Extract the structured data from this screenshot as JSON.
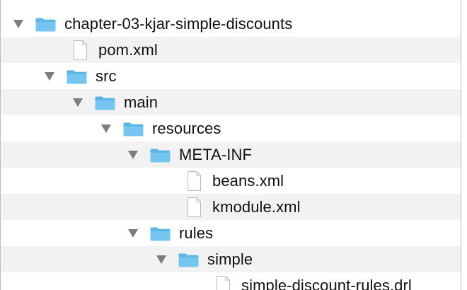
{
  "tree": {
    "items": [
      {
        "label": "chapter-03-kjar-simple-discounts",
        "type": "folder",
        "expanded": true,
        "icon": "folder-icon"
      },
      {
        "label": "pom.xml",
        "type": "file",
        "icon": "file-icon"
      },
      {
        "label": "src",
        "type": "folder",
        "expanded": true,
        "icon": "folder-icon"
      },
      {
        "label": "main",
        "type": "folder",
        "expanded": true,
        "icon": "folder-icon"
      },
      {
        "label": "resources",
        "type": "folder",
        "expanded": true,
        "icon": "folder-icon"
      },
      {
        "label": "META-INF",
        "type": "folder",
        "expanded": true,
        "icon": "folder-icon"
      },
      {
        "label": "beans.xml",
        "type": "file",
        "icon": "file-icon"
      },
      {
        "label": "kmodule.xml",
        "type": "file",
        "icon": "file-icon"
      },
      {
        "label": "rules",
        "type": "folder",
        "expanded": true,
        "icon": "folder-icon"
      },
      {
        "label": "simple",
        "type": "folder",
        "expanded": true,
        "icon": "folder-icon"
      },
      {
        "label": "simple-discount-rules.drl",
        "type": "file",
        "icon": "file-icon"
      }
    ]
  },
  "colors": {
    "folder_fill": "#74c5ef",
    "folder_tab": "#59b5e5",
    "file_stroke": "#b9b9b9",
    "alternate_row": "#f2f2f2",
    "disclosure": "#7d7d7d"
  }
}
